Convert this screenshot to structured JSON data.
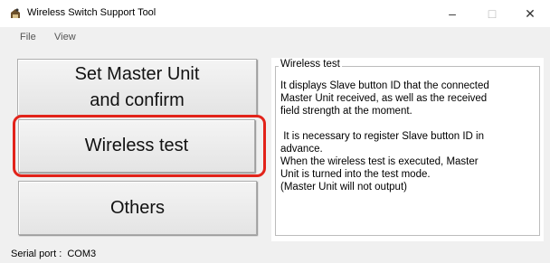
{
  "window": {
    "title": "Wireless Switch Support Tool",
    "minimize": "–",
    "maximize": "□",
    "close": "✕"
  },
  "menu": {
    "items": [
      "File",
      "View"
    ]
  },
  "buttons": {
    "set_master_line1": "Set Master Unit",
    "set_master_line2": "and confirm",
    "wireless_test": "Wireless test",
    "others": "Others"
  },
  "group": {
    "legend": "Wireless test",
    "para1_line1": "It displays Slave button ID that the connected",
    "para1_line2": "Master Unit received, as well as the received",
    "para1_line3": "field strength at the moment.",
    "para2_line1": " It is necessary to register Slave button ID in",
    "para2_line2": "advance.",
    "para2_line3": "When the wireless test is executed, Master",
    "para2_line4": "Unit is turned into the test mode.",
    "para2_line5": "(Master Unit will not output)"
  },
  "status": {
    "serial_port": "Serial port :  COM3"
  },
  "colors": {
    "highlight": "#e2231a",
    "background": "#f0f0f0"
  }
}
